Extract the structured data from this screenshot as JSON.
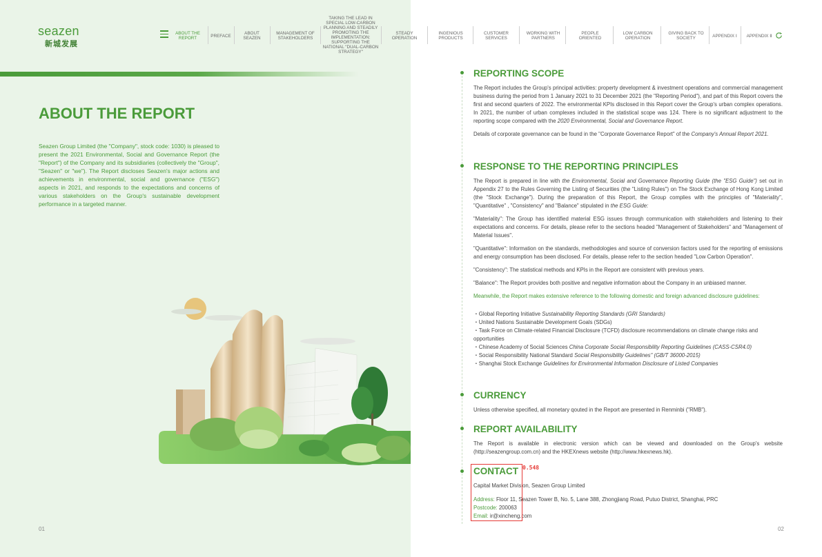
{
  "logo": {
    "en": "seazen",
    "cn": "新城发展"
  },
  "nav": [
    {
      "label": "ABOUT THE REPORT"
    },
    {
      "label": "PREFACE"
    },
    {
      "label": "ABOUT SEAZEN"
    },
    {
      "label": "MANAGEMENT OF STAKEHOLDERS"
    },
    {
      "label": "TAKING THE LEAD IN SPECIAL LOW-CARBON PLANNING AND STEADILY PROMOTING THE IMPLEMENTATION: SUPPORTING THE NATIONAL \"DUAL-CARBON STRATEGY\""
    },
    {
      "label": "STEADY OPERATION"
    },
    {
      "label": "INGENIOUS PRODUCTS"
    },
    {
      "label": "CUSTOMER SERVICES"
    },
    {
      "label": "WORKING WITH PARTNERS"
    },
    {
      "label": "PEOPLE ORIENTED"
    },
    {
      "label": "LOW CARBON OPERATION"
    },
    {
      "label": "GIVING BACK TO SOCIETY"
    },
    {
      "label": "APPENDIX Ⅰ"
    },
    {
      "label": "APPENDIX Ⅱ"
    }
  ],
  "left": {
    "title": "ABOUT THE REPORT",
    "intro": "Seazen Group Limited (the \"Company\", stock code: 1030) is pleased to present the 2021 Environmental, Social and Governance Report (the \"Report\") of the Company and its subsidiaries (collectively the \"Group\", \"Seazen\" or \"we\"). The Report discloses Seazen's major actions and achievements in environmental, social and governance (\"ESG\") aspects in 2021, and responds to the expectations and concerns of various stakeholders on the Group's sustainable development performance in a targeted manner.",
    "page": "01"
  },
  "right": {
    "page": "02",
    "scope": {
      "title": "REPORTING SCOPE",
      "p1": "The Report includes the Group's principal activities: property development & investment operations and commercial management business during the period from 1 January 2021 to 31 December 2021 (the \"Reporting Period\"), and part of this Report covers the first and second quarters of 2022. The environmental KPIs disclosed in this Report cover the Group's urban complex operations. In 2021, the number of urban complexes included in the statistical scope was 124. There is no significant adjustment to the reporting scope compared with the ",
      "p1_ref": "2020 Environmental, Social and Governance Report.",
      "p2": "Details of corporate governance can be found in the \"Corporate Governance Report\" of the ",
      "p2_ref": "Company's Annual Report 2021."
    },
    "principles": {
      "title": "RESPONSE TO THE REPORTING PRINCIPLES",
      "p1a": "The Report is prepared in line with ",
      "p1_guide": "the Environmental, Social and Governance Reporting Guide (the \"ESG Guide\")",
      "p1b": " set out in Appendix 27 to the Rules Governing the Listing of Securities (the \"Listing Rules\") on The Stock Exchange of Hong Kong Limited (the \"Stock Exchange\"). During the preparation of this Report, the Group complies with the principles of \"Materiality\", \"Quantitative\" , \"Consistency\" and \"Balance\" stipulated in ",
      "p1_guide2": "the ESG Guide:",
      "materiality": "\"Materiality\": The Group has identified material ESG issues through communication with stakeholders and listening to their expectations and concerns. For details, please refer to the sections headed \"Management of Stakeholders\" and \"Management of Material Issues\".",
      "quantitative": "\"Quantitative\": Information on the standards, methodologies and source of conversion factors used for the reporting of emissions and energy consumption has been disclosed. For details, please refer to the section headed \"Low Carbon Operation\".",
      "consistency": "\"Consistency\": The statistical methods and KPIs in the Report are consistent with previous years.",
      "balance": "\"Balance\": The Report provides both positive and negative information about the Company in an unbiased manner.",
      "meanwhile": "Meanwhile, the Report makes extensive reference to the following domestic and foreign advanced disclosure guidelines:",
      "guidelines": [
        {
          "pre": "・Global Reporting Initiative ",
          "em": "Sustainability Reporting Standards (GRI Standards)"
        },
        {
          "pre": "・United Nations Sustainable Development Goals (SDGs)",
          "em": ""
        },
        {
          "pre": "・Task Force on Climate-related Financial Disclosure (TCFD) disclosure recommendations on climate change risks and opportunities",
          "em": ""
        },
        {
          "pre": "・Chinese Academy of Social Sciences ",
          "em": "China Corporate Social Responsibility Reporting Guidelines (CASS-CSR4.0)"
        },
        {
          "pre": "・Social Responsibility National Standard ",
          "em": "Social Responsibility Guidelines\" (GB/T 36000-2015)"
        },
        {
          "pre": "・Shanghai Stock Exchange ",
          "em": "Guidelines for Environmental Information Disclosure of Listed Companies"
        }
      ]
    },
    "currency": {
      "title": "CURRENCY",
      "text": "Unless otherwise specified, all monetary qouted in the Report are presented in Renminbi (\"RMB\")."
    },
    "availability": {
      "title": "REPORT AVAILABILITY",
      "text": "The Report is available in electronic version which can be viewed and downloaded on the Group's website (http://seazengroup.com.cn) and the HKEXnews website (http://www.hkexnews.hk)."
    },
    "contact": {
      "title": "CONTACT",
      "division": "Capital Market Division, Seazen Group Limited",
      "address_label": "Address: ",
      "address": "Floor 11, Seazen Tower B, No. 5, Lane 388, Zhongjiang Road, Putuo District, Shanghai, PRC",
      "postcode_label": "Postcode: ",
      "postcode": "200063",
      "email_label": "Email: ",
      "email": "ir@xincheng.com"
    }
  },
  "annotation": {
    "value": "0.548",
    "color": "#e53935"
  },
  "colors": {
    "accent": "#4a9b3a",
    "left_bg": "#eaf4e8"
  }
}
